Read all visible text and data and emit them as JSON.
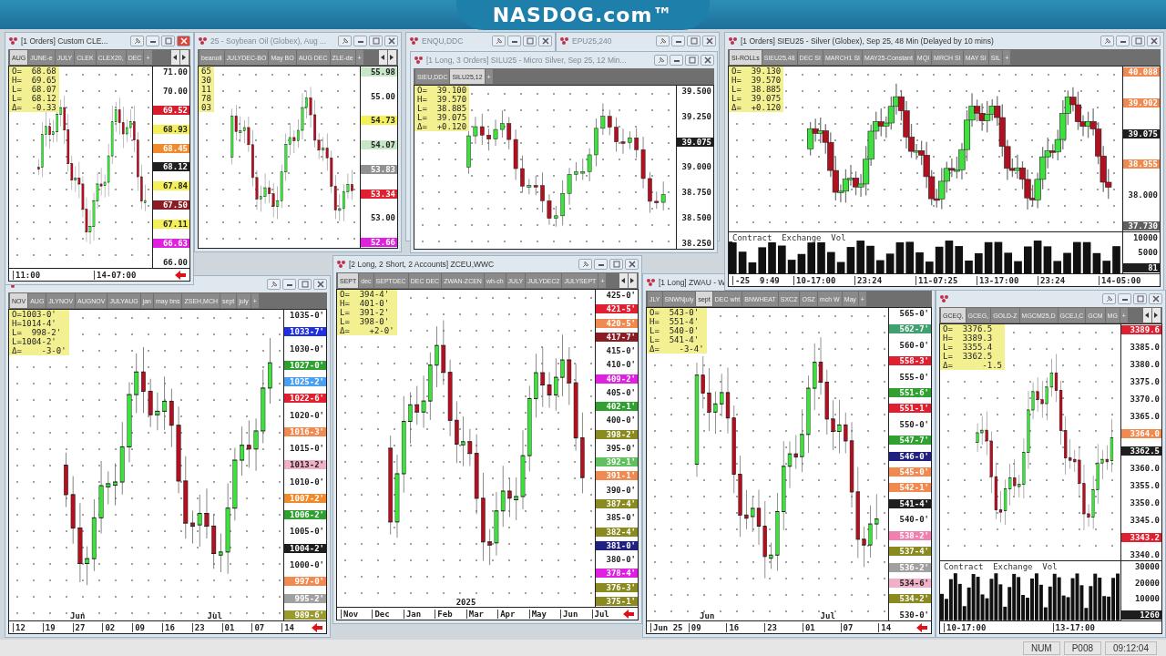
{
  "banner": "NASDOG.com™",
  "windows": [
    {
      "title": "[1 Orders]  Custom CLE...",
      "tabs": [
        {
          "label": "AUG",
          "selected": true
        },
        {
          "label": "JUNE-e",
          "selected": false
        },
        {
          "label": "JULY",
          "selected": false
        },
        {
          "label": "CLEK",
          "selected": false
        },
        {
          "label": "CLEX20,",
          "selected": false
        },
        {
          "label": "DEC",
          "selected": false
        }
      ],
      "add_tab": "+",
      "ohlc": [
        "O=  68.68",
        "H=  69.65",
        "L=  68.07",
        "L=  68.12",
        "Δ=  -0.33"
      ],
      "axis": [
        {
          "label": "71.00"
        },
        {
          "label": "70.00"
        },
        {
          "label": "69.52",
          "color": "#d81e2c"
        },
        {
          "label": "68.93",
          "color": "#f4f05a"
        },
        {
          "label": "68.45",
          "color": "#f08a2c"
        },
        {
          "label": "68.12",
          "color": "#1e1e1e"
        },
        {
          "label": "67.84",
          "color": "#f4f05a"
        },
        {
          "label": "67.50",
          "color": "#8c1c24"
        },
        {
          "label": "67.11",
          "color": "#f4f05a"
        },
        {
          "label": "66.63",
          "color": "#e020e0"
        },
        {
          "label": "66.00"
        }
      ],
      "time": [
        "11:00",
        "14-07:00"
      ]
    },
    {
      "title": "25 - Soybean Oil (Globex), Aug ...",
      "tabs": [
        {
          "label": "beanoil",
          "selected": false
        },
        {
          "label": "JULYDEC-BO",
          "selected": false
        },
        {
          "label": "May BO",
          "selected": false
        },
        {
          "label": "AUG DEC",
          "selected": false
        },
        {
          "label": "ZLE-de",
          "selected": false
        }
      ],
      "add_tab": "+",
      "ohlc": [
        "65",
        "30",
        "11",
        "78",
        "03"
      ],
      "axis": [
        {
          "label": "55.98",
          "color": "#c8e6c8"
        },
        {
          "label": "55.00"
        },
        {
          "label": "54.73",
          "color": "#f4f05a"
        },
        {
          "label": "54.07",
          "color": "#c8e6c8"
        },
        {
          "label": "53.83",
          "color": "#909090"
        },
        {
          "label": "53.34",
          "color": "#e02030"
        },
        {
          "label": "53.00"
        },
        {
          "label": "52.66",
          "color": "#e020e0"
        }
      ]
    },
    {
      "title": "ENQU,DDC"
    },
    {
      "title": "EPU25,240"
    },
    {
      "title": "[1 Long, 3 Orders]  SILU25 - Micro Silver, Sep 25, 12 Min...",
      "tabs": [
        {
          "label": "SIEU,DDC",
          "selected": false
        },
        {
          "label": "SILU25,12",
          "selected": true
        }
      ],
      "add_tab": "+",
      "ohlc": [
        "O=  39.100",
        "H=  39.570",
        "L=  38.885",
        "L=  39.075",
        "Δ=  +0.120"
      ],
      "axis": [
        {
          "label": "39.500"
        },
        {
          "label": "39.250"
        },
        {
          "label": "39.075",
          "color": "#1e1e1e"
        },
        {
          "label": "39.000"
        },
        {
          "label": "38.750"
        },
        {
          "label": "38.500"
        },
        {
          "label": "38.250"
        }
      ]
    },
    {
      "title": "[1 Orders]  SIEU25 - Silver (Globex), Sep 25, 48 Min (Delayed by 10 mins)",
      "tabs": [
        {
          "label": "SI-ROLLs",
          "selected": true
        },
        {
          "label": "SIEU25,48",
          "selected": false
        },
        {
          "label": "DEC SI",
          "selected": false
        },
        {
          "label": "MARCH1 SI",
          "selected": false
        },
        {
          "label": "MAY25-Constant",
          "selected": false
        },
        {
          "label": "MQI",
          "selected": false
        },
        {
          "label": "MRCH SI",
          "selected": false
        },
        {
          "label": "MAY SI",
          "selected": false
        },
        {
          "label": "SIL",
          "selected": false
        }
      ],
      "add_tab": "+",
      "ohlc": [
        "O=  39.130",
        "H=  39.570",
        "L=  38.885",
        "L=  39.075",
        "Δ=  +0.120"
      ],
      "axis": [
        {
          "label": "40.088",
          "color": "#f08a50"
        },
        {
          "label": "39.902",
          "color": "#f08a50"
        },
        {
          "label": "39.075",
          "color": "#1e1e1e"
        },
        {
          "label": "38.955",
          "color": "#f08a50"
        },
        {
          "label": "38.000"
        },
        {
          "label": "37.730",
          "color": "#606060"
        }
      ],
      "volume": {
        "title": "Contract  Exchange  Vol",
        "axis": [
          {
            "label": "10000"
          },
          {
            "label": "5000"
          },
          {
            "label": "81",
            "color": "#1e1e1e"
          }
        ]
      },
      "time": [
        "-25  9:49",
        "10-17:00",
        "23:24",
        "11-07:25",
        "13-17:00",
        "23:24",
        "14-05:00"
      ]
    },
    {
      "tabs": [
        {
          "label": "NOV",
          "selected": true
        },
        {
          "label": "AUG",
          "selected": false
        },
        {
          "label": "JLYNOV",
          "selected": false
        },
        {
          "label": "AUGNOV",
          "selected": false
        },
        {
          "label": "JULYAUG",
          "selected": false
        },
        {
          "label": "jan",
          "selected": false
        },
        {
          "label": "may bns",
          "selected": false
        },
        {
          "label": "ZSEH,MCH",
          "selected": false
        },
        {
          "label": "sept",
          "selected": false
        },
        {
          "label": "july",
          "selected": false
        }
      ],
      "add_tab": "+",
      "ohlc": [
        "O=1003-0'",
        "H=1014-4'",
        "L=  998-2'",
        "L=1004-2'",
        "Δ=    -3-0'"
      ],
      "axis": [
        {
          "label": "1035-0'"
        },
        {
          "label": "1033-7'",
          "color": "#2030e0"
        },
        {
          "label": "1030-0'"
        },
        {
          "label": "1027-0'",
          "color": "#30a030"
        },
        {
          "label": "1025-2'",
          "color": "#4aa0f0"
        },
        {
          "label": "1022-6'",
          "color": "#e02030"
        },
        {
          "label": "1020-0'"
        },
        {
          "label": "1016-3'",
          "color": "#f08a50"
        },
        {
          "label": "1015-0'"
        },
        {
          "label": "1013-2'",
          "color": "#f0b0c8"
        },
        {
          "label": "1010-0'"
        },
        {
          "label": "1007-2'",
          "color": "#f08a2c"
        },
        {
          "label": "1006-2'",
          "color": "#30a030"
        },
        {
          "label": "1005-0'"
        },
        {
          "label": "1004-2'",
          "color": "#1e1e1e"
        },
        {
          "label": "1000-0'"
        },
        {
          "label": "997-0'",
          "color": "#f08a50"
        },
        {
          "label": "995-2'",
          "color": "#a0a0a0"
        },
        {
          "label": "989-6'",
          "color": "#9a9a30"
        }
      ],
      "months": [
        "Jun",
        "Jul"
      ],
      "time": [
        "12",
        "19",
        "27",
        "02",
        "09",
        "16",
        "23",
        "01",
        "07",
        "14"
      ]
    },
    {
      "title": "[2 Long, 2 Short, 2 Accounts]  ZCEU,WWC",
      "tabs": [
        {
          "label": "SEPT",
          "selected": true
        },
        {
          "label": "dec",
          "selected": false
        },
        {
          "label": "SEPTDEC",
          "selected": false
        },
        {
          "label": "DEC DEC",
          "selected": false
        },
        {
          "label": "ZWAN-ZCEN",
          "selected": false
        },
        {
          "label": "wh-ch",
          "selected": false
        },
        {
          "label": "JULY",
          "selected": false
        },
        {
          "label": "JULYDEC2",
          "selected": false
        },
        {
          "label": "JULYSEPT",
          "selected": false
        }
      ],
      "add_tab": "+",
      "ohlc": [
        "O=  394-4'",
        "H=  401-0'",
        "L=  391-2'",
        "L=  398-0'",
        "Δ=    +2-0'"
      ],
      "axis": [
        {
          "label": "425-0'"
        },
        {
          "label": "421-5'",
          "color": "#e02030"
        },
        {
          "label": "420-5'",
          "color": "#f08a50"
        },
        {
          "label": "417-7'",
          "color": "#8c1c24"
        },
        {
          "label": "415-0'"
        },
        {
          "label": "410-0'"
        },
        {
          "label": "409-2'",
          "color": "#e020e0"
        },
        {
          "label": "405-0'"
        },
        {
          "label": "402-1'",
          "color": "#30a030"
        },
        {
          "label": "400-0'"
        },
        {
          "label": "398-2'",
          "color": "#8a8a20"
        },
        {
          "label": "395-0'"
        },
        {
          "label": "392-1'",
          "color": "#60c060"
        },
        {
          "label": "391-1'",
          "color": "#f08a50"
        },
        {
          "label": "390-0'"
        },
        {
          "label": "387-4'",
          "color": "#8a8a20"
        },
        {
          "label": "385-0'"
        },
        {
          "label": "382-4'",
          "color": "#8a8a20"
        },
        {
          "label": "381-0'",
          "color": "#202080"
        },
        {
          "label": "380-0'"
        },
        {
          "label": "378-4'",
          "color": "#e020e0"
        },
        {
          "label": "376-3'",
          "color": "#8a8a20"
        },
        {
          "label": "375-1'",
          "color": "#8a8a20"
        }
      ],
      "months": [
        "2025"
      ],
      "time": [
        "Nov",
        "Dec",
        "Jan",
        "Feb",
        "Mar",
        "Apr",
        "May",
        "Jun",
        "Jul"
      ]
    },
    {
      "title": "[1 Long]  ZWAU - W",
      "tabs": [
        {
          "label": "JLY",
          "selected": false
        },
        {
          "label": "SNWNjuly",
          "selected": false
        },
        {
          "label": "sept",
          "selected": true
        },
        {
          "label": "DEC wht",
          "selected": false
        },
        {
          "label": "BNWHEAT",
          "selected": false
        },
        {
          "label": "SXCZ",
          "selected": false
        },
        {
          "label": "OSZ",
          "selected": false
        },
        {
          "label": "mch W",
          "selected": false
        },
        {
          "label": "May",
          "selected": false
        }
      ],
      "add_tab": "+",
      "ohlc": [
        "O=  543-0'",
        "H=  551-4'",
        "L=  540-0'",
        "L=  541-4'",
        "Δ=    -3-4'"
      ],
      "axis": [
        {
          "label": "565-0'"
        },
        {
          "label": "562-7'",
          "color": "#40a070"
        },
        {
          "label": "560-0'"
        },
        {
          "label": "558-3'",
          "color": "#e02030"
        },
        {
          "label": "555-0'"
        },
        {
          "label": "551-6'",
          "color": "#30a030"
        },
        {
          "label": "551-1'",
          "color": "#e02030"
        },
        {
          "label": "550-0'"
        },
        {
          "label": "547-7'",
          "color": "#30a030"
        },
        {
          "label": "546-0'",
          "color": "#202080"
        },
        {
          "label": "545-0'",
          "color": "#f08a50"
        },
        {
          "label": "542-1'",
          "color": "#f08a50"
        },
        {
          "label": "541-4'",
          "color": "#1e1e1e"
        },
        {
          "label": "540-0'"
        },
        {
          "label": "538-2'",
          "color": "#f080b0"
        },
        {
          "label": "537-4'",
          "color": "#8a8a20"
        },
        {
          "label": "536-2'",
          "color": "#a0a0a0"
        },
        {
          "label": "534-6'",
          "color": "#f0b0c8"
        },
        {
          "label": "534-2'",
          "color": "#8a8a20"
        },
        {
          "label": "530-0'"
        }
      ],
      "months": [
        "Jun",
        "Jul"
      ],
      "time": [
        "Jun 25",
        "09",
        "16",
        "23",
        "01",
        "07",
        "14"
      ]
    },
    {
      "tabs": [
        {
          "label": "GCEQ,",
          "selected": true
        },
        {
          "label": "GCEG,",
          "selected": false
        },
        {
          "label": "GOLD-Z",
          "selected": false
        },
        {
          "label": "MGCM25,D",
          "selected": false
        },
        {
          "label": "GCEJ,C",
          "selected": false
        },
        {
          "label": "GCM",
          "selected": false
        },
        {
          "label": "MG",
          "selected": false
        }
      ],
      "add_tab": "+",
      "ohlc": [
        "O=  3376.5",
        "H=  3389.3",
        "L=  3355.4",
        "L=  3362.5",
        "Δ=      -1.5"
      ],
      "axis": [
        {
          "label": "3389.6",
          "color": "#e02030"
        },
        {
          "label": "3385.0"
        },
        {
          "label": "3380.0"
        },
        {
          "label": "3375.0"
        },
        {
          "label": "3370.0"
        },
        {
          "label": "3365.0"
        },
        {
          "label": "3364.0",
          "color": "#f08a50"
        },
        {
          "label": "3362.5",
          "color": "#1e1e1e"
        },
        {
          "label": "3360.0"
        },
        {
          "label": "3355.0"
        },
        {
          "label": "3350.0"
        },
        {
          "label": "3345.0"
        },
        {
          "label": "3343.2",
          "color": "#e02030"
        },
        {
          "label": "3340.0"
        }
      ],
      "volume": {
        "title": "Contract  Exchange  Vol",
        "axis": [
          {
            "label": "30000"
          },
          {
            "label": "20000"
          },
          {
            "label": "10000"
          },
          {
            "label": "1260",
            "color": "#1e1e1e"
          }
        ]
      },
      "time": [
        "10-17:00",
        "13-17:00"
      ]
    }
  ],
  "status_bar": [
    "NUM",
    "P008",
    "09:12:04"
  ]
}
